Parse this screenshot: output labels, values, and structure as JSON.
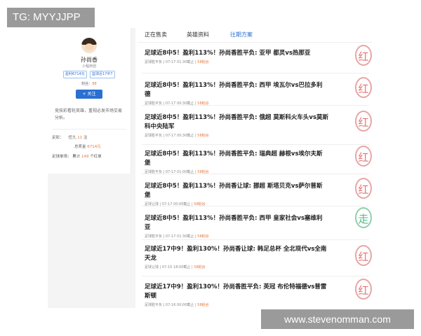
{
  "watermarks": {
    "top": "TG: MYYJJPP",
    "bottom": "www.stevenomman.com"
  },
  "profile": {
    "name": "孙尚香",
    "subtitle": "小程序团",
    "badges": [
      "盈利6714元",
      "篮球近17中7"
    ],
    "fans_label": "粉丝：",
    "fans_value": "88",
    "follow_button": "+ 关注",
    "intro": "竞技彩看轮英雄，重视必发市场交易分析。",
    "stats": {
      "record_label": "足彩：",
      "record_prefix": "任九",
      "record_value": "11",
      "record_suffix": "注",
      "prize_label": "总奖金",
      "prize_value": "6714元",
      "games_label": "足球单场：",
      "games_prefix": "累计",
      "games_value": "149",
      "games_suffix": "个红单"
    }
  },
  "tabs": [
    "正在售卖",
    "英雄资料",
    "往期方案"
  ],
  "items": [
    {
      "title": "足球近8中5！盈利113%！孙尚香胜平负: 亚甲 都灵vs热那亚",
      "type": "足球胜平负",
      "time": "07-17 01:30截止",
      "price": "58稻谷",
      "stamp": "红"
    },
    {
      "title": "足球近8中5！盈利113%！孙尚香胜平负: 西甲 埃瓦尔vs巴拉多利德",
      "type": "足球胜平负",
      "time": "07-17 00:30截止",
      "price": "58稻谷",
      "stamp": "红"
    },
    {
      "title": "足球近8中5！盈利113%！孙尚香胜平负: 俄超 莫斯科火车头vs莫斯科中央陆军",
      "type": "足球胜平负",
      "time": "07-17 00:30截止",
      "price": "58稻谷",
      "stamp": "红"
    },
    {
      "title": "足球近8中5！盈利113%！孙尚香胜平负: 瑞典超 赫根vs埃尔夫斯堡",
      "type": "足球胜平负",
      "time": "07-17 01:00截止",
      "price": "58稻谷",
      "stamp": "红"
    },
    {
      "title": "足球近8中5！盈利113%！孙尚香让球: 挪超 斯塔贝克vs萨尔普斯堡",
      "type": "足球让球",
      "time": "07-17 00:00截止",
      "price": "58稻谷",
      "stamp": "红"
    },
    {
      "title": "足球近8中5！盈利113%！孙尚香胜平负: 西甲 皇家社会vs塞维利亚",
      "type": "足球胜平负",
      "time": "07-17 01:30截止",
      "price": "58稻谷",
      "stamp": "走"
    },
    {
      "title": "足球近17中9！盈利130%！孙尚香让球: 韩足总杯 全北现代vs全南天龙",
      "type": "足球让球",
      "time": "07-15 18:00截止",
      "price": "58稻谷",
      "stamp": "红"
    },
    {
      "title": "足球近17中9！盈利130%！孙尚香胜平负: 英冠 布伦特福德vs普雷斯顿",
      "type": "足球胜平负",
      "time": "07-16 00:00截止",
      "price": "58稻谷",
      "stamp": "红"
    }
  ]
}
